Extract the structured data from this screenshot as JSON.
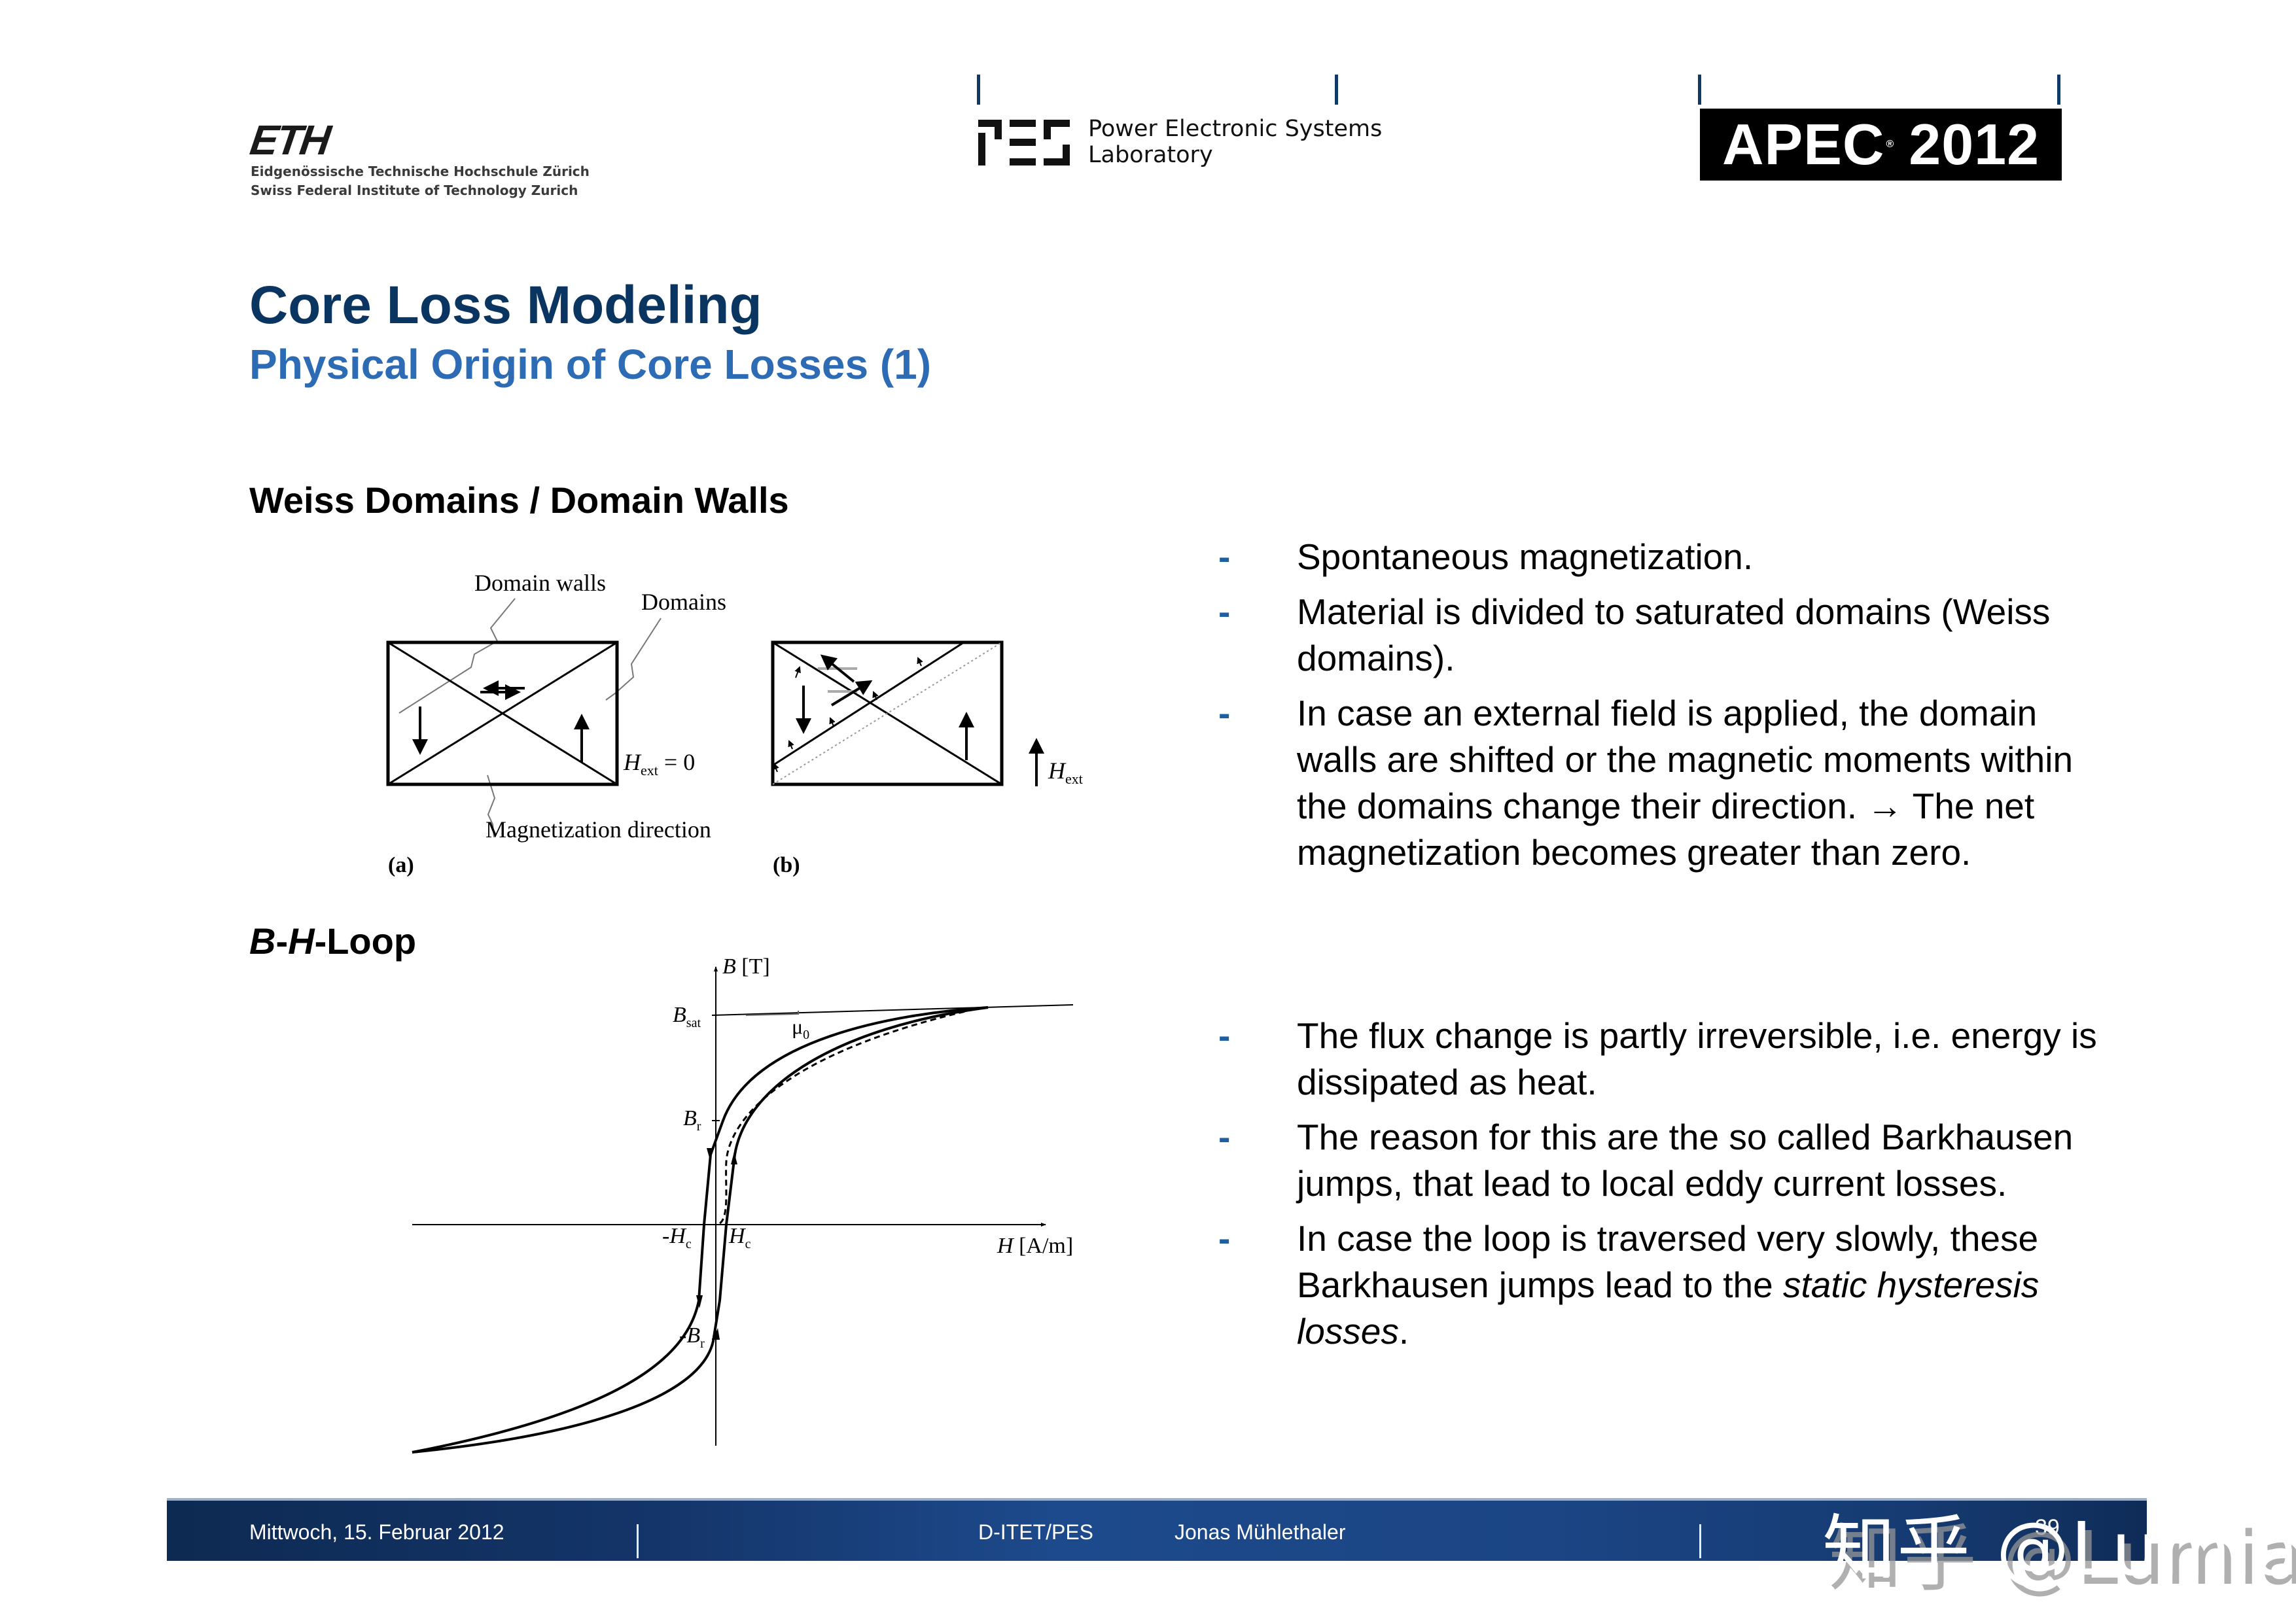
{
  "header": {
    "eth": {
      "mark": "ETH",
      "line1": "Eidgenössische Technische Hochschule Zürich",
      "line2": "Swiss Federal Institute of Technology Zurich"
    },
    "pes": {
      "mark_icon": "pes-logo-icon",
      "line1": "Power Electronic Systems",
      "line2": "Laboratory"
    },
    "apec": {
      "name": "APEC",
      "registered": "®",
      "year": "2012"
    }
  },
  "slide": {
    "title": "Core Loss Modeling",
    "subtitle": "Physical Origin of Core Losses (1)",
    "section1": "Weiss Domains / Domain Walls",
    "section2": {
      "b": "B",
      "dash1": "-",
      "h": "H",
      "rest": "-Loop"
    }
  },
  "domain_figure": {
    "label_domain_walls": "Domain walls",
    "label_domains": "Domains",
    "label_magnetization": "Magnetization direction",
    "label_hext_zero_h": "H",
    "label_hext_zero_sub": "ext",
    "label_hext_zero_eq": " = 0",
    "label_hext_h": "H",
    "label_hext_sub": "ext",
    "caption_a": "(a)",
    "caption_b": "(b)"
  },
  "bh_figure": {
    "y_axis_label": "B",
    "y_axis_unit": " [T]",
    "x_axis_label": "H",
    "x_axis_unit": " [A/m]",
    "bsat": "B",
    "bsat_sub": "sat",
    "mu0": "μ",
    "mu0_sub": "0",
    "br": "B",
    "br_sub": "r",
    "neg_br": "-B",
    "neg_br_sub": "r",
    "hc": "H",
    "hc_sub": "c",
    "neg_hc": "-H",
    "neg_hc_sub": "c"
  },
  "bullets_top": [
    {
      "dash": "-",
      "text": "Spontaneous magnetization."
    },
    {
      "dash": "-",
      "text": "Material is divided to saturated domains (Weiss domains)."
    },
    {
      "dash": "-",
      "text_before": "In case an external field is applied, the domain walls are shifted or the magnetic moments within the domains change their direction. ",
      "arrow": "→",
      "text_after": " The net magnetization becomes greater than zero."
    }
  ],
  "bullets_bottom": [
    {
      "dash": "-",
      "text": "The flux change is partly irreversible, i.e. energy is dissipated as heat."
    },
    {
      "dash": "-",
      "text": "The reason for this are the so called Barkhausen jumps, that lead to local eddy current losses."
    },
    {
      "dash": "-",
      "text_before": "In case the loop is traversed very slowly, these Barkhausen jumps lead to the ",
      "emph": "static hysteresis losses",
      "text_after": "."
    }
  ],
  "footer": {
    "date": "Mittwoch, 15. Februar 2012",
    "department": "D-ITET/PES",
    "author": "Jonas Mühlethaler",
    "page": "39"
  },
  "watermark": {
    "text": "知乎 @Lumia"
  },
  "colors": {
    "title": "#0b3561",
    "subtitle": "#2d6cb5",
    "bullet_dash": "#1d5fa0",
    "footer_bg": "#1b4584"
  }
}
